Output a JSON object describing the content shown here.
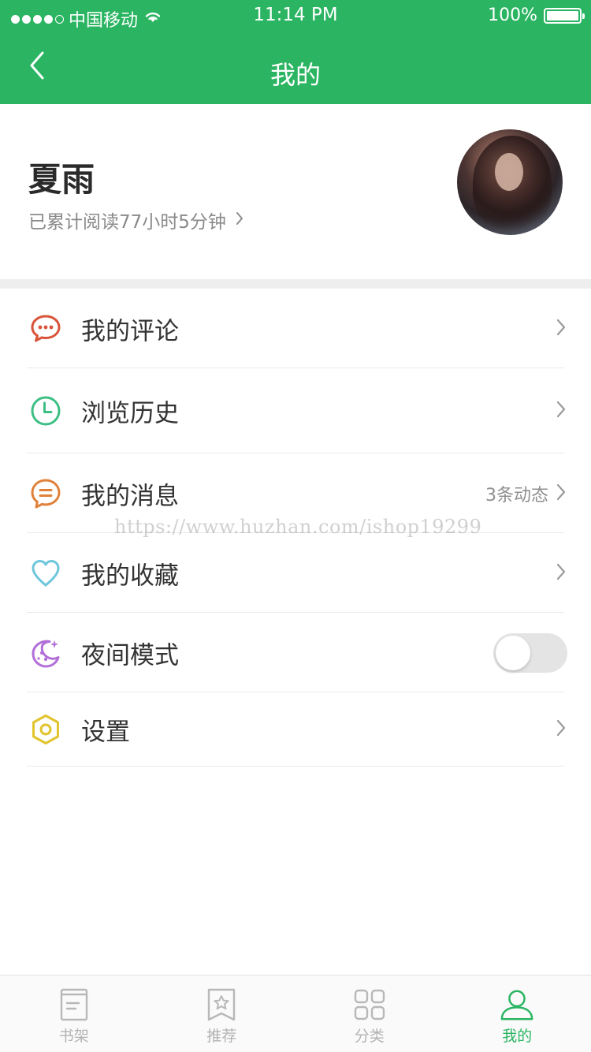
{
  "status_bar": {
    "carrier": "中国移动",
    "time": "11:14 PM",
    "battery": "100%"
  },
  "nav": {
    "title": "我的"
  },
  "profile": {
    "name": "夏雨",
    "reading_time": "已累计阅读77小时5分钟"
  },
  "menu": {
    "items": [
      {
        "label": "我的评论",
        "icon": "comment-bubble-icon",
        "color": "#d9543a"
      },
      {
        "label": "浏览历史",
        "icon": "clock-icon",
        "color": "#3dbf84"
      },
      {
        "label": "我的消息",
        "icon": "message-icon",
        "color": "#e0813a",
        "extra": "3条动态"
      },
      {
        "label": "我的收藏",
        "icon": "heart-icon",
        "color": "#6ec6dc"
      },
      {
        "label": "夜间模式",
        "icon": "moon-icon",
        "color": "#b270d8",
        "toggle": false
      },
      {
        "label": "设置",
        "icon": "settings-hexagon-icon",
        "color": "#e2c42c"
      }
    ]
  },
  "watermark": "https://www.huzhan.com/ishop19299",
  "tab_bar": {
    "tabs": [
      {
        "label": "书架",
        "icon": "bookshelf-icon",
        "active": false
      },
      {
        "label": "推荐",
        "icon": "star-bookmark-icon",
        "active": false
      },
      {
        "label": "分类",
        "icon": "grid-icon",
        "active": false
      },
      {
        "label": "我的",
        "icon": "person-icon",
        "active": true
      }
    ],
    "active_color": "#2bb562",
    "inactive_color": "#b3b3b3"
  },
  "colors": {
    "brand_green": "#2bb562"
  }
}
